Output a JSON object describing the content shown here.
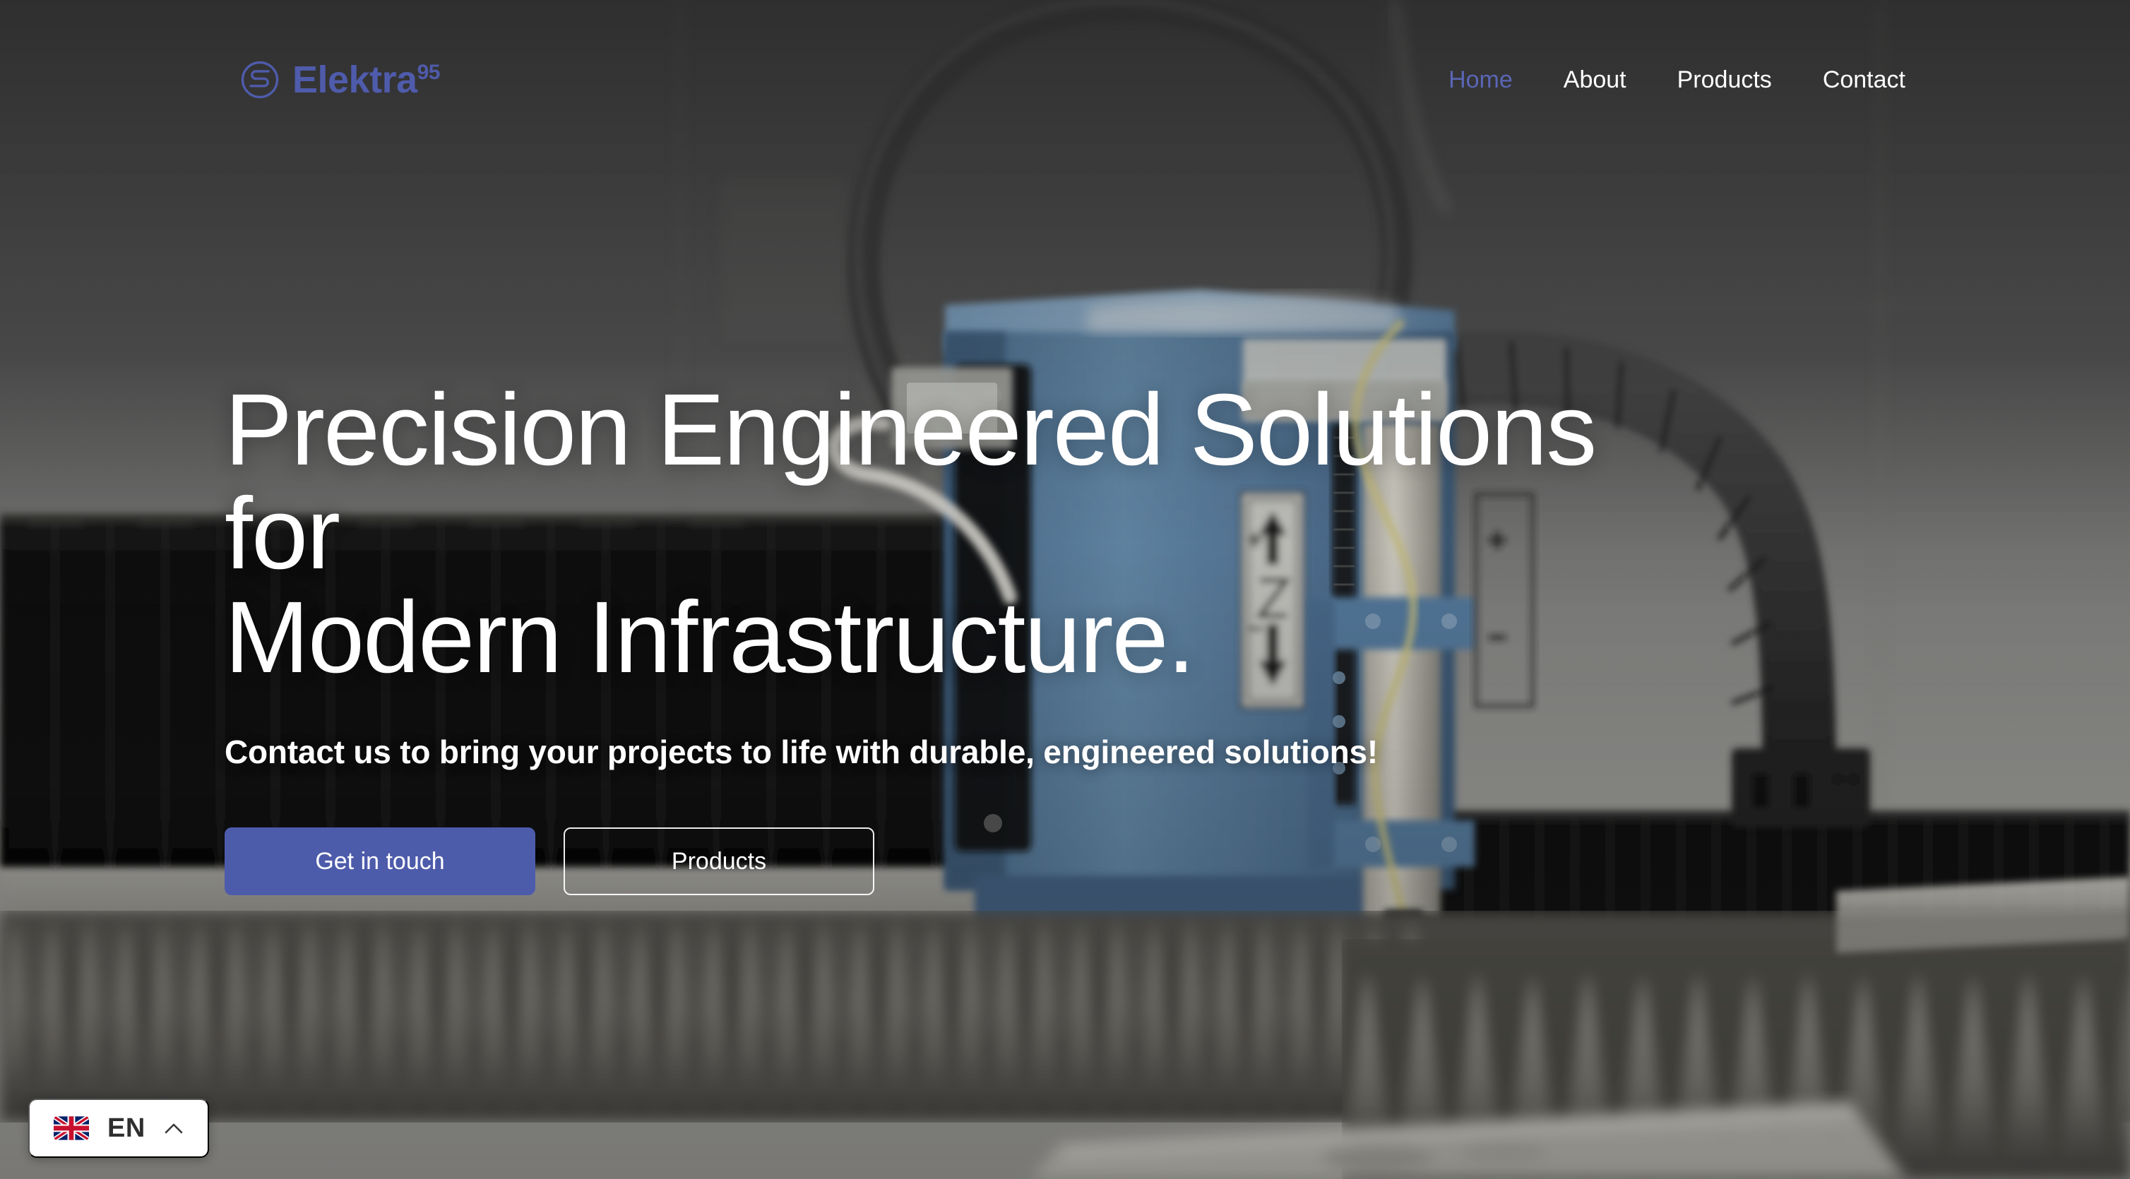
{
  "brand": {
    "name": "Elektra",
    "superscript": "95",
    "logo_icon": "serpentine-circle-icon",
    "color": "#4f5bab"
  },
  "nav": {
    "items": [
      {
        "label": "Home",
        "active": true
      },
      {
        "label": "About",
        "active": false
      },
      {
        "label": "Products",
        "active": false
      },
      {
        "label": "Contact",
        "active": false
      }
    ],
    "active_color": "#5a66b5",
    "link_color": "#ffffff"
  },
  "hero": {
    "headline": "Precision Engineered Solutions for\nModern Infrastructure.",
    "headline_line_1": "Precision Engineered Solutions for",
    "headline_line_2": "Modern Infrastructure.",
    "subheadline": "Contact us to bring your projects to life with durable, engineered solutions!",
    "primary_cta": "Get in touch",
    "secondary_cta": "Products",
    "primary_cta_color": "#4d5bab",
    "text_color": "#ffffff",
    "background_description": "CNC plasma cutting machine head with cable carrier over a slat cutting bed"
  },
  "language_switcher": {
    "code": "EN",
    "flag_icon": "uk-flag-icon",
    "caret_icon": "chevron-up-icon",
    "background": "#ffffff",
    "text_color": "#2f2f2f"
  }
}
